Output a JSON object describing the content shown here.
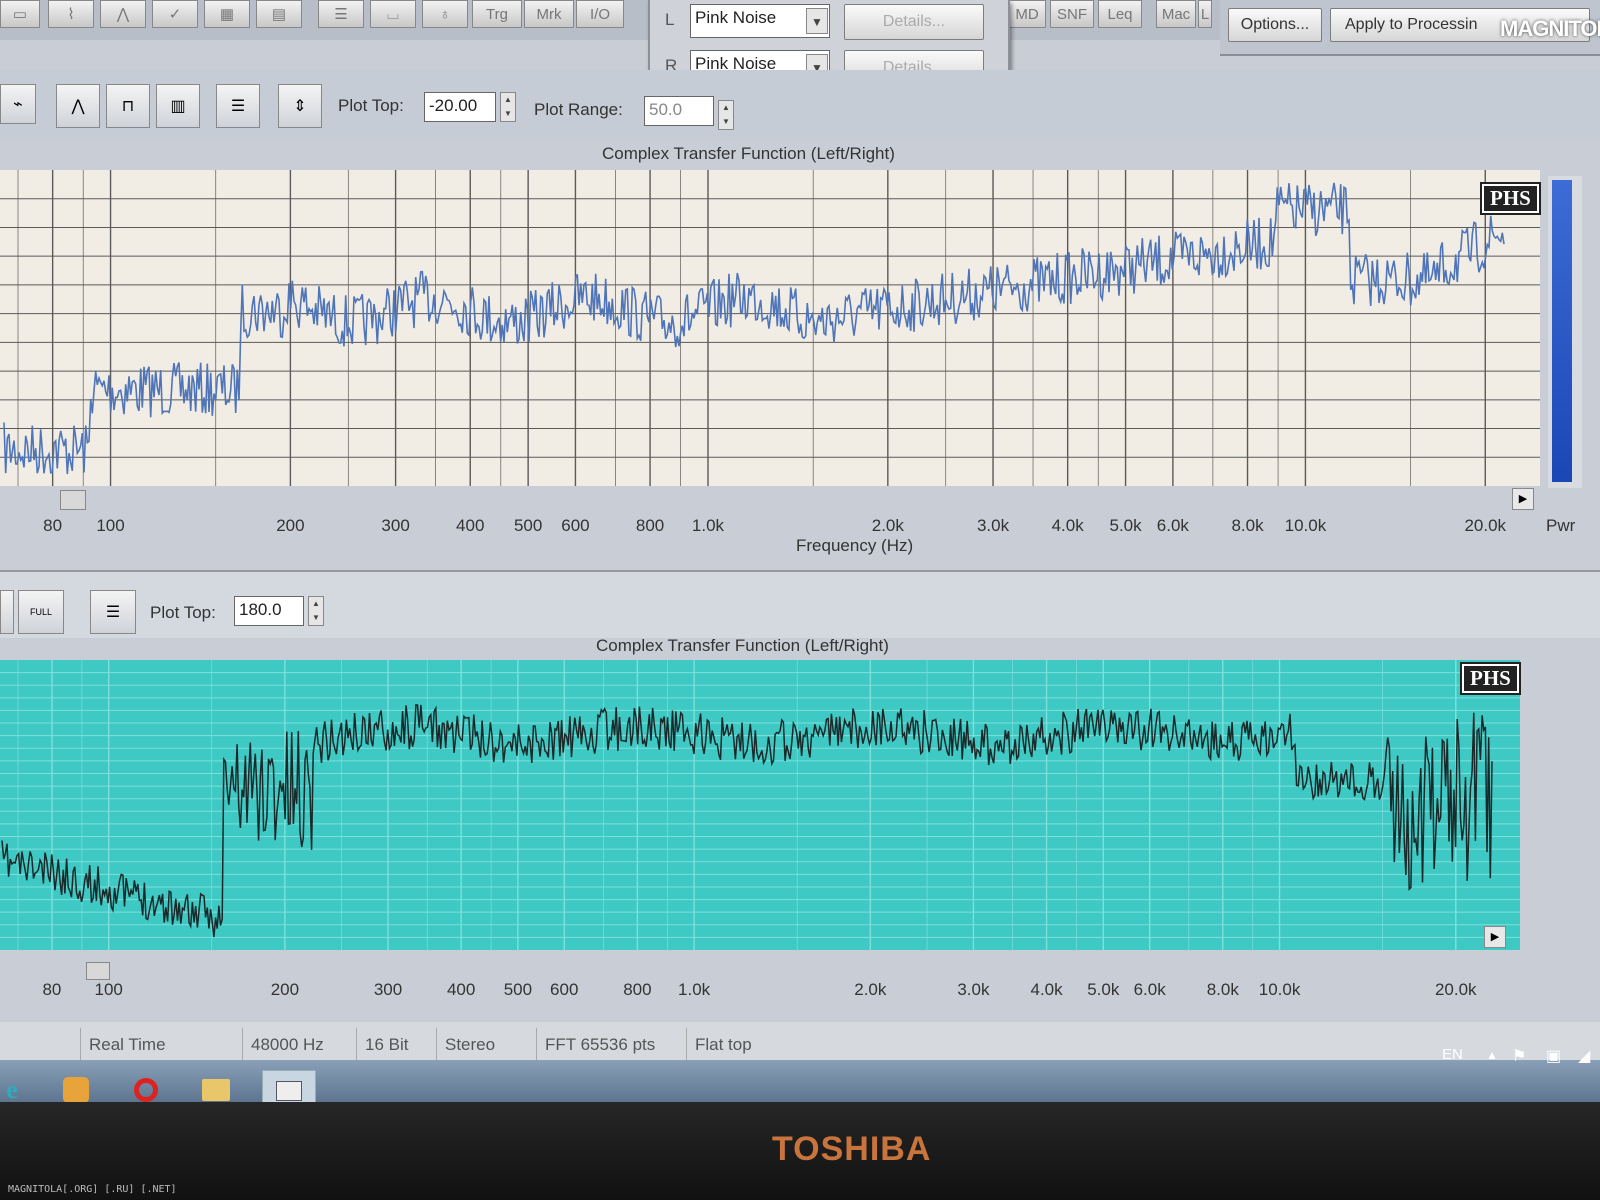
{
  "toolbar_top": {
    "tools": [
      "Trg",
      "Mrk",
      "I/O"
    ],
    "tools_right": [
      "MD",
      "SNF",
      "Leq",
      "Mac",
      "L"
    ],
    "options_label": "Options...",
    "apply_label": "Apply to Processin",
    "watermark": "MAGNITOLA"
  },
  "generator": {
    "left_channel": "L",
    "right_channel": "R",
    "left_signal": "Pink Noise",
    "right_signal": "Pink Noise",
    "details_label": "Details..."
  },
  "panel1": {
    "plot_top_label": "Plot Top:",
    "plot_top_value": "-20.00",
    "plot_range_label": "Plot Range:",
    "plot_range_value": "50.0",
    "title": "Complex Transfer Function (Left/Right)",
    "badge": "PHS",
    "x_label": "Frequency (Hz)",
    "pwr_label": "Pwr",
    "ticks": [
      "80",
      "100",
      "200",
      "300",
      "400",
      "500",
      "600",
      "800",
      "1.0k",
      "2.0k",
      "3.0k",
      "4.0k",
      "5.0k",
      "6.0k",
      "8.0k",
      "10.0k",
      "20.0k"
    ],
    "trace_color": "#4f75b8",
    "background_color": "#f1ede4"
  },
  "panel2": {
    "full_label": "FULL",
    "plot_top_label": "Plot Top:",
    "plot_top_value": "180.0",
    "title": "Complex Transfer Function (Left/Right)",
    "badge": "PHS",
    "ticks": [
      "80",
      "100",
      "200",
      "300",
      "400",
      "500",
      "600",
      "800",
      "1.0k",
      "2.0k",
      "3.0k",
      "4.0k",
      "5.0k",
      "6.0k",
      "8.0k",
      "10.0k",
      "20.0k"
    ],
    "trace_color": "#1a2a2a",
    "background_color": "#3ec9c4"
  },
  "status_bar": {
    "mode": "Real Time",
    "sample_rate": "48000 Hz",
    "bit_depth": "16 Bit",
    "channels": "Stereo",
    "fft": "FFT 65536 pts",
    "window": "Flat top"
  },
  "tray": {
    "language": "EN"
  },
  "laptop": {
    "brand": "TOSHIBA",
    "footer_text": "MAGNITOLA[.ORG] [.RU] [.NET]"
  }
}
